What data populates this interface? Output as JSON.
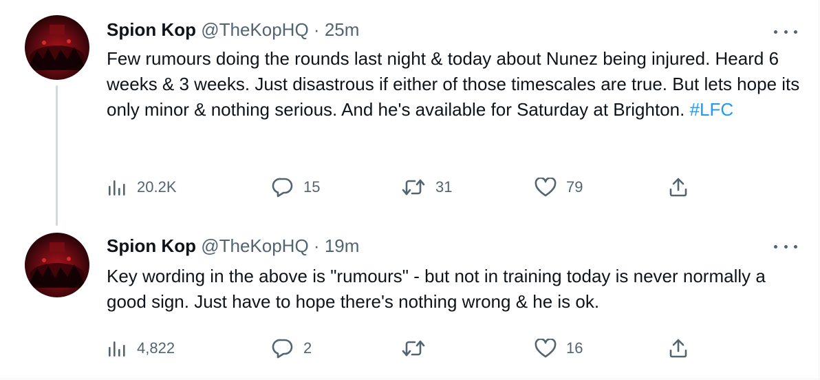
{
  "tweets": [
    {
      "display_name": "Spion Kop",
      "handle": "@TheKopHQ",
      "separator": "·",
      "time": "25m",
      "text_before": "Few rumours doing the rounds last night & today about Nunez being injured. Heard 6 weeks & 3 weeks. Just disastrous if either of those timescales are true. But lets hope its only minor & nothing serious. And he's available for Saturday at Brighton. ",
      "hashtag": "#LFC",
      "stats": {
        "views": "20.2K",
        "replies": "15",
        "retweets": "31",
        "likes": "79"
      },
      "icons": [
        "views-icon",
        "reply-icon",
        "retweet-icon",
        "like-icon",
        "share-icon",
        "more-icon"
      ]
    },
    {
      "display_name": "Spion Kop",
      "handle": "@TheKopHQ",
      "separator": "·",
      "time": "19m",
      "text_before": "Key wording in the above is \"rumours\" - but not in training today is never normally a good sign. Just have to hope there's nothing wrong & he is ok.",
      "hashtag": "",
      "stats": {
        "views": "4,822",
        "replies": "2",
        "retweets": "",
        "likes": "16"
      },
      "icons": [
        "views-icon",
        "reply-icon",
        "retweet-icon",
        "like-icon",
        "share-icon",
        "more-icon"
      ]
    }
  ],
  "colors": {
    "text": "#0f1419",
    "secondary": "#536471",
    "link": "#1d9bf0",
    "thread_line": "#cfd9de"
  }
}
